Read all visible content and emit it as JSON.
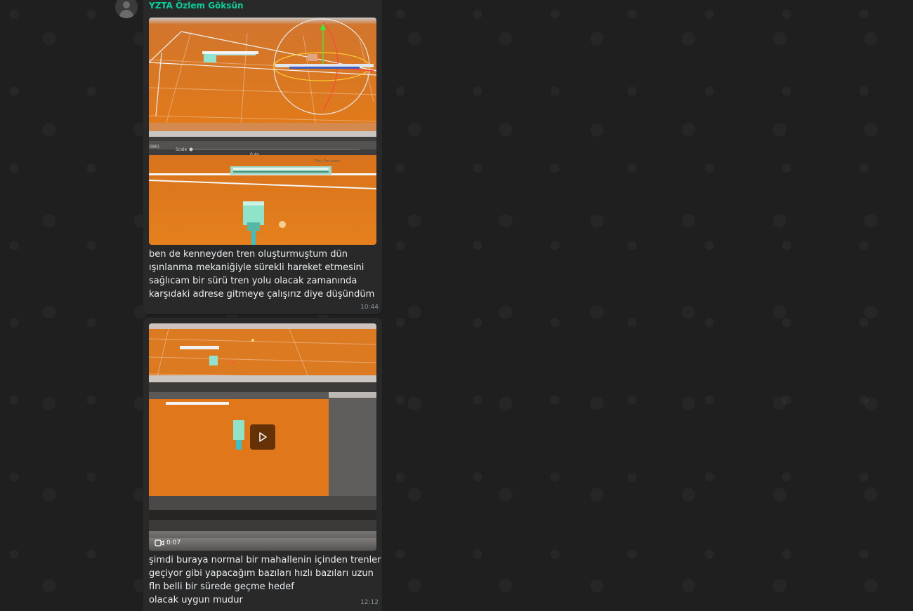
{
  "messages": [
    {
      "sender": "YZTA Özlem Göksün",
      "media_type": "image",
      "caption_lines": [
        "ben de kenneyden tren oluşturmuştum dün",
        "ışınlanma mekaniğiyle sürekli hareket etmesini",
        "sağlıcam bir sürü tren yolu olacak zamanında",
        "karşıdaki adrese gitmeye çalışırız diye düşündüm"
      ],
      "time": "10:44",
      "embedded_text": {
        "scale_label": "Scale",
        "scale_value": "0.4x",
        "play_mode": "Play Focused",
        "resolution": "080)"
      }
    },
    {
      "media_type": "video",
      "video_duration": "0:07",
      "caption_lines": [
        "şimdi buraya normal bir mahallenin içinden trenler",
        "geçiyor gibi yapacağım bazıları hızlı bazıları uzun",
        "fln belli bir sürede geçme hedef",
        "olacak uygun mudur"
      ],
      "time": "12:12"
    }
  ],
  "icons": {
    "avatar": "default-user-icon",
    "play": "play-icon",
    "video": "video-camera-icon"
  },
  "colors": {
    "chat_background": "#1f1f1f",
    "bubble": "#292929",
    "sender_name": "#06cf9c",
    "text": "#e9edef",
    "timestamp": "#8696a0",
    "scene_orange": "#d8741f"
  }
}
